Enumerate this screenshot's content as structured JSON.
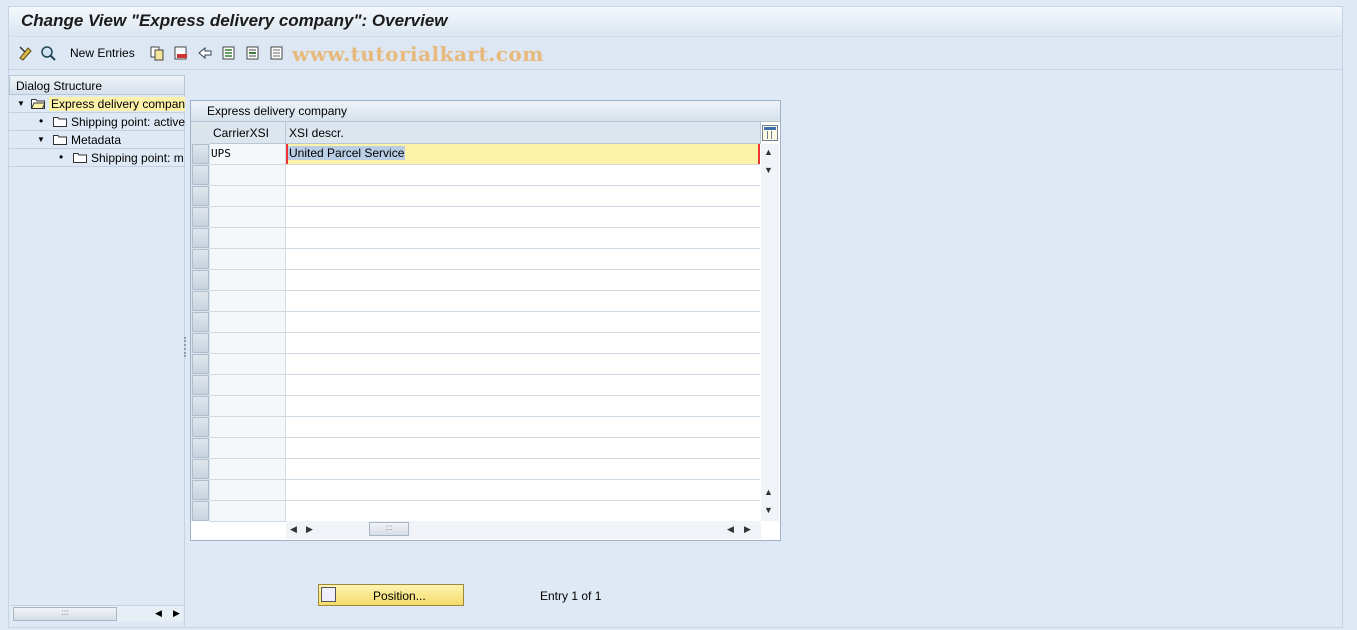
{
  "window": {
    "title": "Change View \"Express delivery company\": Overview"
  },
  "toolbar": {
    "new_entries_label": "New Entries",
    "watermark": "www.tutorialkart.com",
    "icons": [
      "display-change-icon",
      "details-icon",
      "copy-icon",
      "delete-icon",
      "undo-icon",
      "select-all-icon",
      "select-block-icon",
      "deselect-all-icon"
    ]
  },
  "dialog_structure": {
    "header": "Dialog Structure",
    "items": [
      {
        "label": "Express delivery company",
        "level": 0,
        "expanded": true,
        "selected": true,
        "open_folder": true
      },
      {
        "label": "Shipping point: active",
        "level": 1,
        "expanded": false,
        "selected": false,
        "open_folder": false
      },
      {
        "label": "Metadata",
        "level": 1,
        "expanded": true,
        "selected": false,
        "open_folder": false
      },
      {
        "label": "Shipping point: m",
        "level": 2,
        "expanded": false,
        "selected": false,
        "open_folder": false
      }
    ]
  },
  "table": {
    "caption": "Express delivery company",
    "columns": [
      "CarrierXSI",
      "XSI descr."
    ],
    "rows": [
      {
        "carrier": "UPS",
        "description": "United Parcel Service"
      }
    ],
    "visible_row_count": 18
  },
  "footer": {
    "position_button_label": "Position...",
    "entry_info": "Entry 1 of 1"
  },
  "colors": {
    "background": "#dfe9f5",
    "selected_row": "#fdf2a8",
    "highlight_text": "#b9cde4",
    "button_yellow": "#f4dc6a"
  }
}
